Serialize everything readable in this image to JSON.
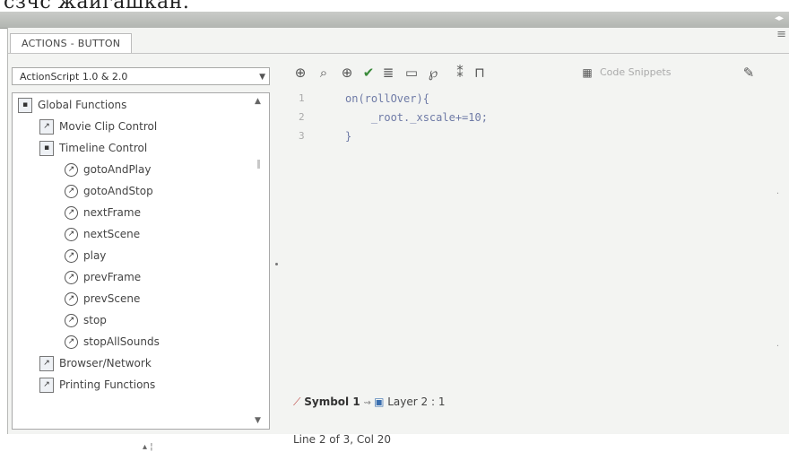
{
  "top_caption": "сзчс жайгашкан.",
  "window": {
    "tab_label": "ACTIONS - BUTTON"
  },
  "version_selector": {
    "selected": "ActionScript 1.0 & 2.0"
  },
  "tree": {
    "items": [
      {
        "label": "Global Functions",
        "kind": "book-open",
        "indent": 0
      },
      {
        "label": "Movie Clip Control",
        "kind": "book",
        "indent": 1
      },
      {
        "label": "Timeline Control",
        "kind": "book-open",
        "indent": 1
      },
      {
        "label": "gotoAndPlay",
        "kind": "fn",
        "indent": 2
      },
      {
        "label": "gotoAndStop",
        "kind": "fn",
        "indent": 2
      },
      {
        "label": "nextFrame",
        "kind": "fn",
        "indent": 2
      },
      {
        "label": "nextScene",
        "kind": "fn",
        "indent": 2
      },
      {
        "label": "play",
        "kind": "fn",
        "indent": 2
      },
      {
        "label": "prevFrame",
        "kind": "fn",
        "indent": 2
      },
      {
        "label": "prevScene",
        "kind": "fn",
        "indent": 2
      },
      {
        "label": "stop",
        "kind": "fn",
        "indent": 2
      },
      {
        "label": "stopAllSounds",
        "kind": "fn",
        "indent": 2
      },
      {
        "label": "Browser/Network",
        "kind": "book",
        "indent": 1
      },
      {
        "label": "Printing Functions",
        "kind": "book",
        "indent": 1
      }
    ]
  },
  "toolbar": {
    "icons": [
      "add-statement-icon",
      "find-icon",
      "insert-target-path-icon",
      "check-syntax-icon",
      "auto-format-icon",
      "show-code-hint-icon",
      "debug-options-icon",
      "collapse-icon",
      "expand-icon",
      "script-assist-icon"
    ],
    "code_snippets_label": "Code Snippets"
  },
  "editor": {
    "lines": [
      {
        "num": "1",
        "code": "on(rollOver){"
      },
      {
        "num": "2",
        "code": "    _root._xscale+=10;"
      },
      {
        "num": "3",
        "code": "}"
      }
    ]
  },
  "status": {
    "symbol": "Symbol 1",
    "layer": "Layer 2 : 1",
    "line_info": "Line 2 of 3, Col 20"
  }
}
